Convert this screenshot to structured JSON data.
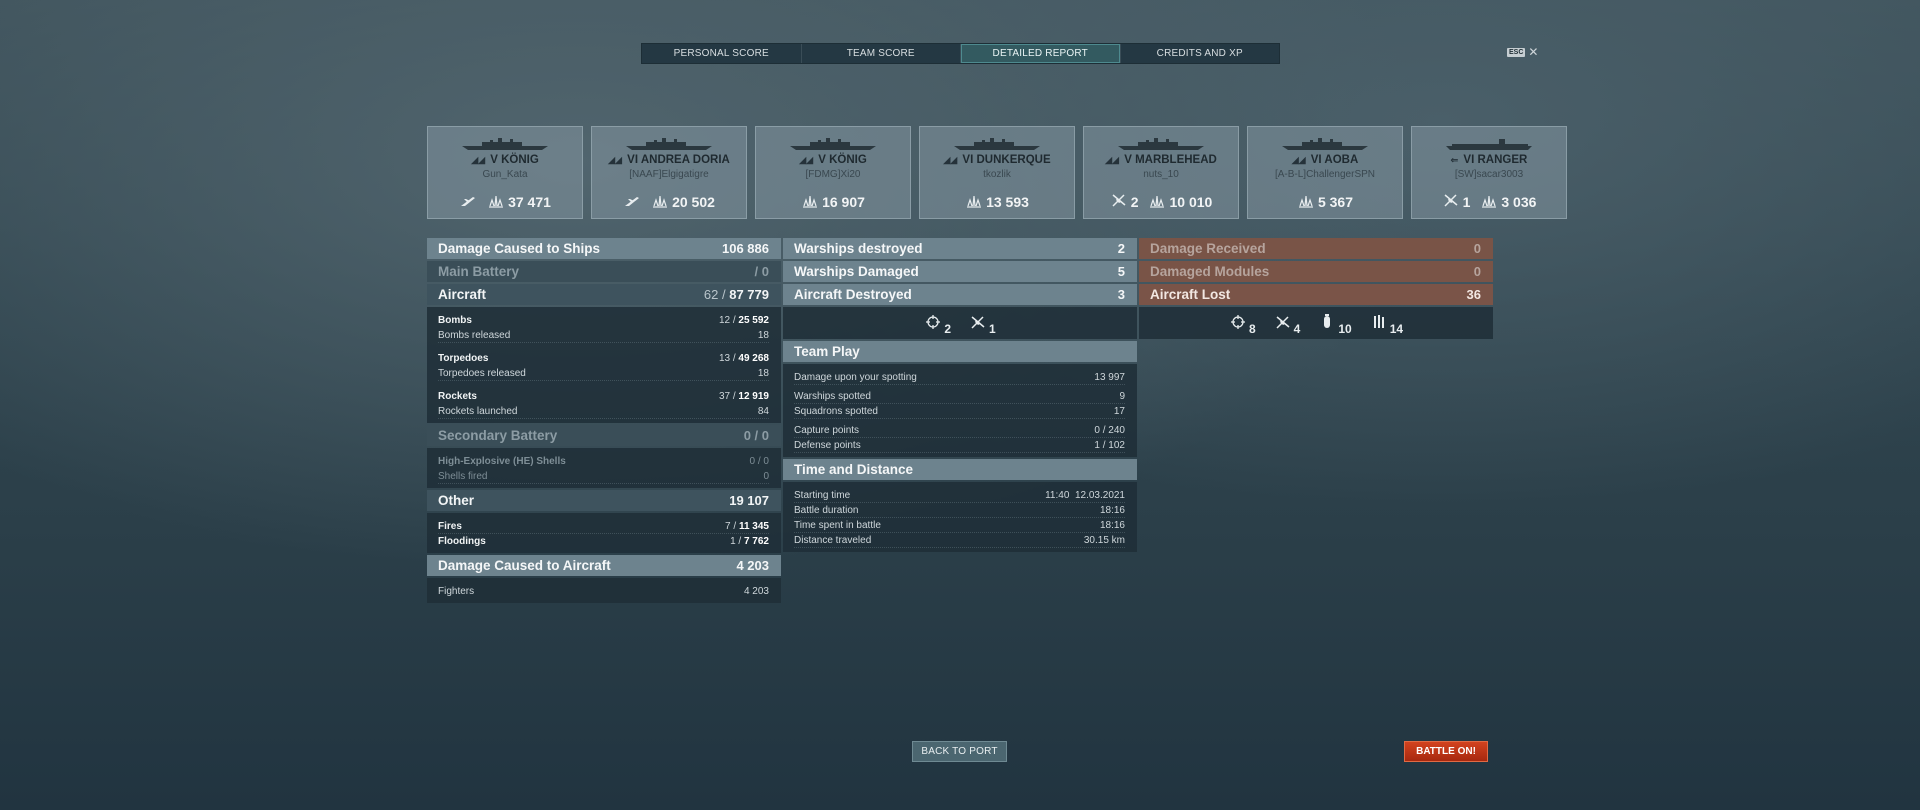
{
  "tabs": [
    {
      "label": "PERSONAL SCORE"
    },
    {
      "label": "TEAM SCORE"
    },
    {
      "label": "DETAILED REPORT"
    },
    {
      "label": "CREDITS AND XP"
    }
  ],
  "esc": {
    "key": "ESC",
    "close": "✕"
  },
  "players": [
    {
      "tier": "V",
      "ship": "KÖNIG",
      "player": "Gun_Kata",
      "icon1": "plane-kill-icon",
      "count1": "",
      "damage": "37 471"
    },
    {
      "tier": "VI",
      "ship": "ANDREA DORIA",
      "player": "[NAAF]Elgigatigre",
      "icon1": "plane-kill-icon",
      "count1": "",
      "damage": "20 502"
    },
    {
      "tier": "V",
      "ship": "KÖNIG",
      "player": "[FDMG]Xi20",
      "icon1": "",
      "count1": "",
      "damage": "16 907"
    },
    {
      "tier": "VI",
      "ship": "DUNKERQUE",
      "player": "tkozlik",
      "icon1": "",
      "count1": "",
      "damage": "13 593"
    },
    {
      "tier": "V",
      "ship": "MARBLEHEAD",
      "player": "nuts_10",
      "icon1": "plane-destroyed-icon",
      "count1": "2",
      "damage": "10 010"
    },
    {
      "tier": "VI",
      "ship": "AOBA",
      "player": "[A-B-L]ChallengerSPN",
      "icon1": "",
      "count1": "",
      "damage": "5 367"
    },
    {
      "tier": "VI",
      "ship": "RANGER",
      "player": "[SW]sacar3003",
      "icon1": "plane-destroyed-icon",
      "count1": "1",
      "damage": "3 036"
    }
  ],
  "damage": {
    "title": "Damage Caused to Ships",
    "total": "106 886",
    "main_battery": {
      "label": "Main Battery",
      "value": "/ 0"
    },
    "aircraft": {
      "label": "Aircraft",
      "hits": "62",
      "value": "87 779"
    },
    "bombs": {
      "label": "Bombs",
      "hits": "12",
      "value": "25 592",
      "released_label": "Bombs released",
      "released": "18"
    },
    "torpedoes": {
      "label": "Torpedoes",
      "hits": "13",
      "value": "49 268",
      "released_label": "Torpedoes released",
      "released": "18"
    },
    "rockets": {
      "label": "Rockets",
      "hits": "37",
      "value": "12 919",
      "released_label": "Rockets launched",
      "released": "84"
    },
    "secondary": {
      "label": "Secondary Battery",
      "value": "0 / 0"
    },
    "he_shells": {
      "label": "High-Explosive (HE) Shells",
      "value": "0 / 0"
    },
    "shells_fired": {
      "label": "Shells fired",
      "value": "0"
    },
    "other": {
      "label": "Other",
      "value": "19 107"
    },
    "fires": {
      "label": "Fires",
      "hits": "7",
      "value": "11 345"
    },
    "floodings": {
      "label": "Floodings",
      "hits": "1",
      "value": "7 762"
    },
    "aircraft_dmg": {
      "label": "Damage Caused to Aircraft",
      "value": "4 203"
    },
    "fighters": {
      "label": "Fighters",
      "value": "4 203"
    }
  },
  "kills": {
    "warships_destroyed": {
      "label": "Warships destroyed",
      "value": "2"
    },
    "warships_damaged": {
      "label": "Warships Damaged",
      "value": "5"
    },
    "aircraft_destroyed": {
      "label": "Aircraft Destroyed",
      "value": "3"
    },
    "icons": [
      {
        "icon": "crosshair-icon",
        "value": "2"
      },
      {
        "icon": "plane-destroyed-icon",
        "value": "1"
      }
    ]
  },
  "team_play": {
    "title": "Team Play",
    "rows": [
      {
        "label": "Damage upon your spotting",
        "value": "13 997"
      },
      {
        "label": "Warships spotted",
        "value": "9"
      },
      {
        "label": "Squadrons spotted",
        "value": "17"
      },
      {
        "label": "Capture points",
        "value": "0 / 240"
      },
      {
        "label": "Defense points",
        "value": "1 / 102"
      }
    ]
  },
  "time_distance": {
    "title": "Time and Distance",
    "rows": [
      {
        "label": "Starting time",
        "value": "11:40  12.03.2021"
      },
      {
        "label": "Battle duration",
        "value": "18:16"
      },
      {
        "label": "Time spent in battle",
        "value": "18:16"
      },
      {
        "label": "Distance traveled",
        "value": "30.15 km"
      }
    ]
  },
  "received": {
    "damage_received": {
      "label": "Damage Received",
      "value": "0"
    },
    "damaged_modules": {
      "label": "Damaged Modules",
      "value": "0"
    },
    "aircraft_lost": {
      "label": "Aircraft Lost",
      "value": "36"
    },
    "icons": [
      {
        "icon": "crosshair-icon",
        "value": "8"
      },
      {
        "icon": "plane-destroyed-icon",
        "value": "4"
      },
      {
        "icon": "bomb-icon",
        "value": "10"
      },
      {
        "icon": "torpedo-icon",
        "value": "14"
      }
    ]
  },
  "buttons": {
    "back_to_port": "BACK TO PORT",
    "battle_on": "BATTLE ON!"
  }
}
